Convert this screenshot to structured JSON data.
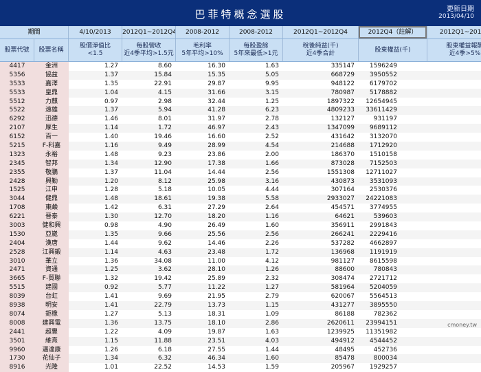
{
  "header": {
    "title": "巴菲特概念選股",
    "update_label": "更新日期",
    "update_date": "2013/04/10"
  },
  "period_headers": [
    "期間",
    "4/10/2013",
    "2012Q1~2012Q4",
    "2008-2012",
    "2008-2012",
    "2012Q1~2012Q4",
    "2012Q4（註解）",
    "2012Q1~2012Q"
  ],
  "metric_headers": [
    [
      "股票代號"
    ],
    [
      "股票名稱"
    ],
    [
      "股價淨值比",
      "<1.5"
    ],
    [
      "每股營收",
      "近4季平均>1.5元"
    ],
    [
      "毛利率",
      "5年平均>10%"
    ],
    [
      "每股盈餘",
      "5年來最低>1元"
    ],
    [
      "稅後純益(千)",
      "近4季合計"
    ],
    [
      "股東權益(千)"
    ],
    [
      "股東權益報酬",
      "近4季>5%"
    ]
  ],
  "rows": [
    [
      "4417",
      "金洲",
      "1.27",
      "8.60",
      "16.30",
      "1.63",
      "335147",
      "1596249",
      "21"
    ],
    [
      "5356",
      "協益",
      "1.37",
      "15.84",
      "15.35",
      "5.05",
      "668729",
      "3950552",
      "16.93"
    ],
    [
      "3533",
      "嘉澤",
      "1.35",
      "22.91",
      "29.87",
      "9.95",
      "948122",
      "6179702",
      "15.34"
    ],
    [
      "5533",
      "皇鼎",
      "1.04",
      "4.15",
      "31.66",
      "3.15",
      "780987",
      "5178882",
      "15.08"
    ],
    [
      "5512",
      "力麒",
      "0.97",
      "2.98",
      "32.44",
      "1.25",
      "1897322",
      "12654945",
      "14.99"
    ],
    [
      "5522",
      "遠雄",
      "1.37",
      "5.94",
      "41.28",
      "6.23",
      "4809233",
      "33611429",
      "14.31"
    ],
    [
      "6292",
      "迅德",
      "1.46",
      "8.01",
      "31.97",
      "2.78",
      "132127",
      "931197",
      "14.19"
    ],
    [
      "2107",
      "厚生",
      "1.14",
      "1.72",
      "46.97",
      "2.43",
      "1347099",
      "9689112",
      "13.9"
    ],
    [
      "6152",
      "百一",
      "1.40",
      "19.46",
      "16.60",
      "2.52",
      "431642",
      "3132070",
      "13.78"
    ],
    [
      "5215",
      "F-科嘉",
      "1.16",
      "9.49",
      "28.99",
      "4.54",
      "214688",
      "1712920",
      "12.53"
    ],
    [
      "1323",
      "永裕",
      "1.48",
      "9.23",
      "23.86",
      "2.00",
      "186370",
      "1510158",
      "12.34"
    ],
    [
      "2345",
      "智邦",
      "1.34",
      "12.90",
      "17.38",
      "1.66",
      "873028",
      "7152503",
      "12.21"
    ],
    [
      "2355",
      "敬鵬",
      "1.37",
      "11.04",
      "14.44",
      "2.56",
      "1551308",
      "12711027",
      "12.2"
    ],
    [
      "2428",
      "興勤",
      "1.20",
      "8.12",
      "25.98",
      "3.16",
      "430873",
      "3531093",
      "12.2"
    ],
    [
      "1525",
      "江申",
      "1.28",
      "5.18",
      "10.05",
      "4.44",
      "307164",
      "2530376",
      "12.14"
    ],
    [
      "3044",
      "健鼎",
      "1.48",
      "18.61",
      "19.38",
      "5.58",
      "2933027",
      "24221083",
      "12.11"
    ],
    [
      "1708",
      "東鹼",
      "1.42",
      "6.31",
      "27.29",
      "2.64",
      "454571",
      "3774955",
      "12.04"
    ],
    [
      "6221",
      "晉泰",
      "1.30",
      "12.70",
      "18.20",
      "1.16",
      "64621",
      "539603",
      "11.98"
    ],
    [
      "3003",
      "健和興",
      "0.98",
      "4.90",
      "26.49",
      "1.60",
      "356911",
      "2991843",
      "11.93"
    ],
    [
      "1530",
      "亞崴",
      "1.35",
      "9.66",
      "25.56",
      "2.56",
      "266241",
      "2229416",
      "11.58"
    ],
    [
      "2404",
      "漢唐",
      "1.44",
      "9.62",
      "14.46",
      "2.26",
      "537282",
      "4662897",
      "11.52"
    ],
    [
      "2528",
      "江興鍛",
      "1.14",
      "4.63",
      "23.48",
      "1.72",
      "136968",
      "1191919",
      "11.49"
    ],
    [
      "3010",
      "華立",
      "1.36",
      "34.08",
      "11.00",
      "4.12",
      "981127",
      "8615598",
      "11.39"
    ],
    [
      "2471",
      "資通",
      "1.25",
      "3.62",
      "28.10",
      "1.26",
      "88600",
      "780843",
      "11.35"
    ],
    [
      "3665",
      "F-貿聯",
      "1.32",
      "19.42",
      "25.89",
      "2.32",
      "308474",
      "2721712",
      "11.33"
    ],
    [
      "5515",
      "建國",
      "0.92",
      "5.77",
      "11.22",
      "1.27",
      "581964",
      "5204059",
      "11.18"
    ],
    [
      "8039",
      "台虹",
      "1.41",
      "9.69",
      "21.95",
      "2.79",
      "620067",
      "5564513",
      "11.14"
    ],
    [
      "8938",
      "明安",
      "1.41",
      "22.79",
      "13.73",
      "1.15",
      "431277",
      "3895550",
      "11.07"
    ],
    [
      "8074",
      "鉅橡",
      "1.27",
      "5.13",
      "18.31",
      "1.09",
      "86188",
      "782362",
      "11.02"
    ],
    [
      "8008",
      "建興電",
      "1.36",
      "13.75",
      "18.10",
      "2.86",
      "2620611",
      "23994151",
      "10.92"
    ],
    [
      "2441",
      "超豐",
      "1.22",
      "4.09",
      "19.87",
      "1.63",
      "1239925",
      "11351982",
      "10.92"
    ],
    [
      "3501",
      "維熹",
      "1.15",
      "11.88",
      "23.51",
      "4.03",
      "494912",
      "4544452",
      "10.89"
    ],
    [
      "9960",
      "邁達康",
      "1.26",
      "6.18",
      "27.55",
      "1.44",
      "48495",
      "452736",
      "10.71"
    ],
    [
      "1730",
      "花仙子",
      "1.34",
      "6.32",
      "46.34",
      "1.60",
      "85478",
      "800034",
      "10.68"
    ],
    [
      "8916",
      "光隆",
      "1.01",
      "22.52",
      "14.53",
      "1.59",
      "205967",
      "1929257",
      "10.68"
    ]
  ],
  "watermark": "cmoney.tw"
}
